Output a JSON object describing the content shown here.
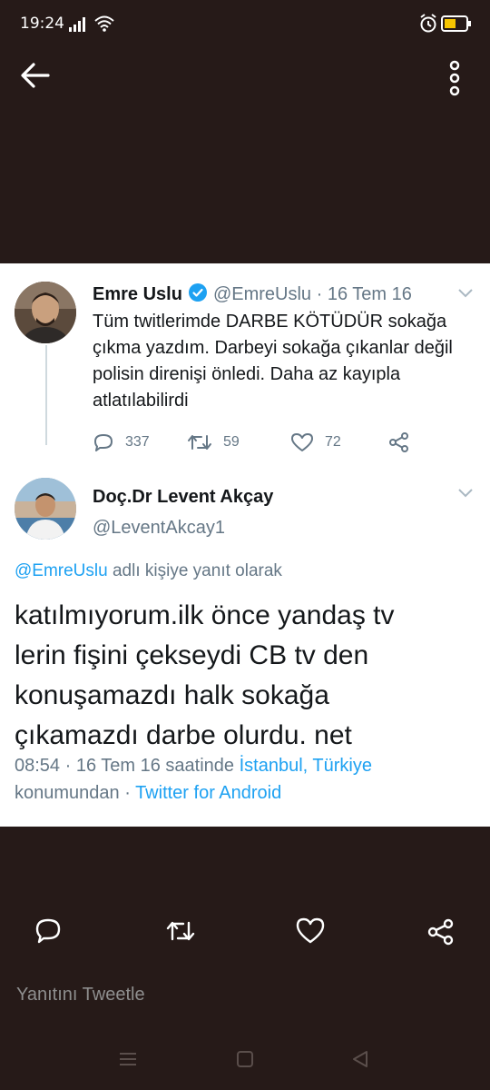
{
  "status_bar": {
    "time": "19:24"
  },
  "original_tweet": {
    "name": "Emre Uslu",
    "handle": "@EmreUslu",
    "date": "· 16 Tem 16",
    "text": "Tüm twitlerimde DARBE KÖTÜDÜR sokağa çıkma yazdım. Darbeyi sokağa çıkanlar değil polisin direnişi önledi. Daha az kayıpla atlatılabilirdi",
    "reply_count": "337",
    "retweet_count": "59",
    "like_count": "72"
  },
  "reply_tweet": {
    "name": "Doç.Dr Levent Akçay",
    "handle": "@LeventAkcay1",
    "reply_to_handle": "@EmreUslu",
    "reply_to_suffix": " adlı kişiye yanıt olarak",
    "text": "katılmıyorum.ilk önce yandaş tv lerin fişini çekseydi CB tv den konuşamazdı halk sokağa çıkamazdı darbe olurdu. net",
    "time": "08:54",
    "date_phrase": " · 16 Tem 16 saatinde ",
    "location": "İstanbul, Türkiye",
    "location_suffix": "konumundan · ",
    "source": "Twitter for Android"
  },
  "composer": {
    "placeholder": "Yanıtını Tweetle"
  },
  "colors": {
    "background": "#261a18",
    "card": "#ffffff",
    "link": "#1da1f2",
    "muted": "#657786"
  },
  "icons": [
    "back-arrow-icon",
    "more-vertical-icon",
    "verified-icon",
    "reply-icon",
    "retweet-icon",
    "like-icon",
    "share-icon"
  ]
}
